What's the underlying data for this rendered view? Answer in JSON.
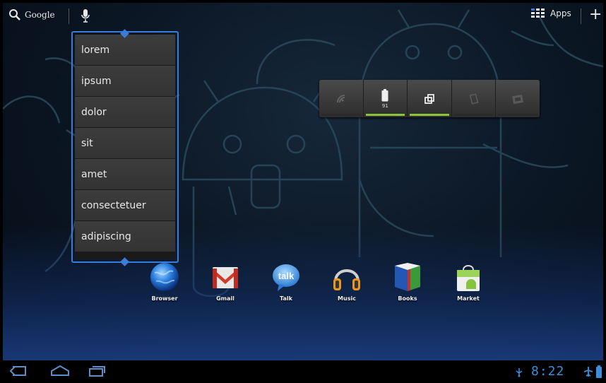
{
  "top_bar": {
    "search_label": "Google",
    "apps_label": "Apps"
  },
  "list_widget": {
    "items": [
      "lorem",
      "ipsum",
      "dolor",
      "sit",
      "amet",
      "consectetuer",
      "adipiscing"
    ]
  },
  "power_control": {
    "battery_level": "91",
    "buttons": [
      {
        "icon": "wifi-icon",
        "active": false
      },
      {
        "icon": "battery-icon",
        "active": true
      },
      {
        "icon": "screen-rotation-icon",
        "active": true
      },
      {
        "icon": "sync-icon",
        "active": false
      },
      {
        "icon": "brightness-icon",
        "active": false
      }
    ]
  },
  "dock": {
    "apps": [
      {
        "label": "Browser",
        "icon": "browser-icon"
      },
      {
        "label": "Gmail",
        "icon": "gmail-icon"
      },
      {
        "label": "Talk",
        "icon": "talk-icon"
      },
      {
        "label": "Music",
        "icon": "music-icon"
      },
      {
        "label": "Books",
        "icon": "books-icon"
      },
      {
        "label": "Market",
        "icon": "market-icon"
      }
    ]
  },
  "system_bar": {
    "time": "8:22"
  },
  "colors": {
    "accent_blue": "#3d7bd8",
    "indicator_green": "#8ac43f",
    "clock_blue": "#3a8fd8"
  }
}
